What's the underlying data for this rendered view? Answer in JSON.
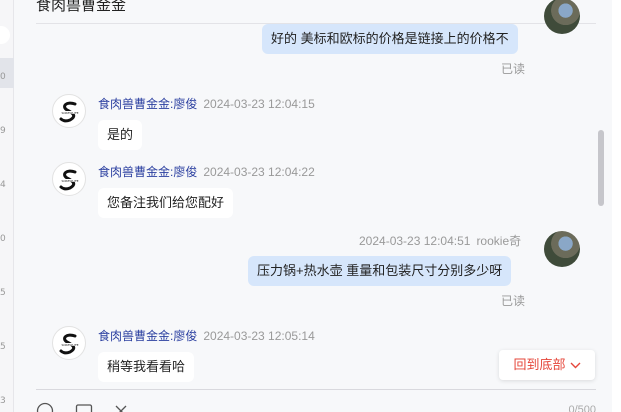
{
  "left_strip": {
    "numbers": [
      "0",
      "9",
      "4",
      "0",
      "5",
      "5",
      "3"
    ]
  },
  "header": {
    "title": "食肉兽曹金金"
  },
  "messages": [
    {
      "side": "right",
      "text": "好的 美标和欧标的价格是链接上的价格不",
      "status": "已读"
    },
    {
      "side": "left",
      "sender": "食肉兽曹金金:廖俊",
      "time": "2024-03-23 12:04:15",
      "text": "是的"
    },
    {
      "side": "left",
      "sender": "食肉兽曹金金:廖俊",
      "time": "2024-03-23 12:04:22",
      "text": "您备注我们给您配好"
    },
    {
      "side": "right",
      "sender": "rookie奇",
      "time": "2024-03-23 12:04:51",
      "text": "压力锅+热水壶   重量和包装尺寸分别多少呀",
      "status": "已读"
    },
    {
      "side": "left",
      "sender": "食肉兽曹金金:廖俊",
      "time": "2024-03-23 12:05:14",
      "text": "稍等我看看哈"
    }
  ],
  "back_to_bottom": {
    "label": "回到底部"
  },
  "input": {
    "counter": "0/500"
  },
  "icons": [
    "emoji-icon",
    "image-icon",
    "scissors-icon",
    "chevron-down-icon"
  ],
  "colors": {
    "self_bubble": "#d6e6fb",
    "other_bubble": "#ffffff",
    "sender_name": "#2b3fa0",
    "back_button_text": "#e5463a"
  }
}
